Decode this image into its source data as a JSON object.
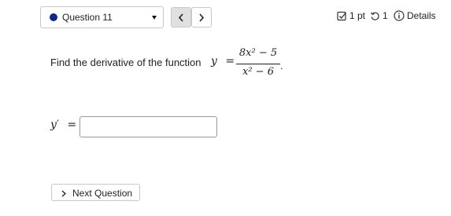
{
  "header": {
    "question_select": {
      "label": "Question 11"
    },
    "points": "1 pt",
    "attempts": "1",
    "details": "Details"
  },
  "question": {
    "prompt": "Find the derivative of the function",
    "func_var": "y",
    "equals": "=",
    "numerator": "8x² − 5",
    "denominator": "x² − 6",
    "period": "."
  },
  "answer": {
    "label": "y′",
    "equals": "=",
    "value": "",
    "placeholder": ""
  },
  "footer": {
    "next_label": "Next Question"
  },
  "colors": {
    "dot": "#0b2a8c",
    "border": "#c8c8c8",
    "prev_button_bg": "#e0e0e0"
  }
}
